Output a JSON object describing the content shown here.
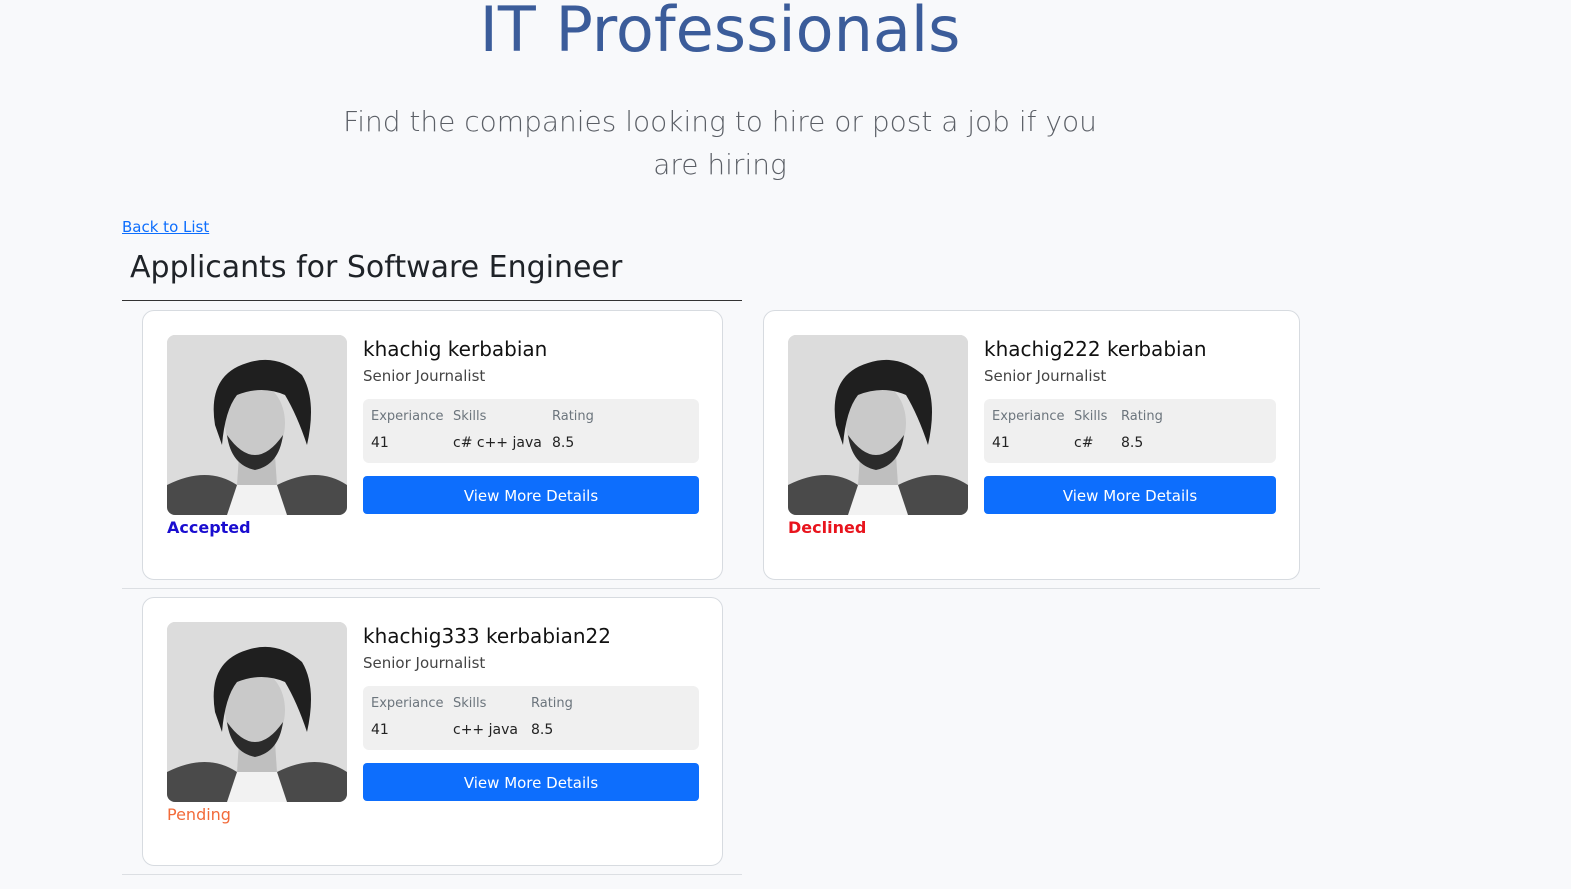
{
  "header": {
    "title": "IT Professionals",
    "subtitle": "Find the companies looking to hire or post a job if you are hiring"
  },
  "nav": {
    "back_link": "Back to List"
  },
  "section": {
    "title": "Applicants for Software Engineer"
  },
  "labels": {
    "experience": "Experiance",
    "skills": "Skills",
    "rating": "Rating",
    "details_button": "View More Details"
  },
  "applicants": [
    {
      "name": "khachig kerbabian",
      "role": "Senior Journalist",
      "experience": "41",
      "skills": "c# c++ java",
      "rating": "8.5",
      "status": "Accepted",
      "status_color": "#1a0dd0",
      "avatar_icon": "applicant-photo"
    },
    {
      "name": "khachig222 kerbabian",
      "role": "Senior Journalist",
      "experience": "41",
      "skills": "c#",
      "rating": "8.5",
      "status": "Declined",
      "status_color": "#e8141d",
      "avatar_icon": "applicant-photo"
    },
    {
      "name": "khachig333 kerbabian22",
      "role": "Senior Journalist",
      "experience": "41",
      "skills": "c++ java",
      "rating": "8.5",
      "status": "Pending",
      "status_color": "#f26b3a",
      "avatar_icon": "applicant-photo"
    }
  ],
  "colors": {
    "title": "#3b5c9a",
    "primary_button": "#0d6efd",
    "link": "#0d6efd"
  }
}
